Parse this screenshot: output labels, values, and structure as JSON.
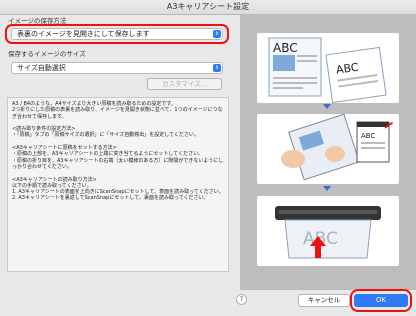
{
  "window": {
    "title": "A3キャリアシート設定"
  },
  "save_method": {
    "label": "イメージの保存方法",
    "value": "表裏のイメージを見開きにして保存します"
  },
  "output_size": {
    "label": "保存するイメージのサイズ",
    "value": "サイズ自動選択",
    "custom_button": "カスタマイズ..."
  },
  "description": {
    "lines": [
      "A3 / B4のような、A4サイズより大きい原稿を読み取るための設定です。",
      "2つ折りにした原稿の表裏を読み取り、イメージを見開き状態に並べて、1つのイメージにつなぎ合わせて保存します。",
      "",
      "<読み取り条件の設定方法>",
      "・「原稿」タブの「原稿サイズの選択」に「サイズ自動検出」を設定してください。",
      "",
      "<A3キャリアシートに原稿をセットする方法>",
      "・原稿の上部を、A3キャリアシートの上端に突き当てるようにセットしてください。",
      "・原稿の折り目を、A3キャリアシートの右端（太い模様のある方）に隙間ができないようにしっかり合わせてください。",
      "",
      "<A3キャリアシートの読み取り方法>",
      "以下の手順で読み取ってください。",
      "1. A3キャリアシートの表面を上向きにScanSnapにセットして、表面を読み取ってください。",
      "2. A3キャリアシートを裏返してScanSnapにセットして、裏面を読み取ってください。"
    ]
  },
  "illustration": {
    "card1": {
      "left_text": "ABC",
      "right_text": "ABC"
    },
    "card2": {
      "small_text": "ABC"
    },
    "card3": {
      "text": "ABC"
    }
  },
  "footer": {
    "help": "?",
    "cancel": "キャンセル",
    "ok": "OK"
  },
  "colors": {
    "accent": "#2f7bf5",
    "highlight": "#e11111",
    "panel": "#bdbdbd"
  }
}
